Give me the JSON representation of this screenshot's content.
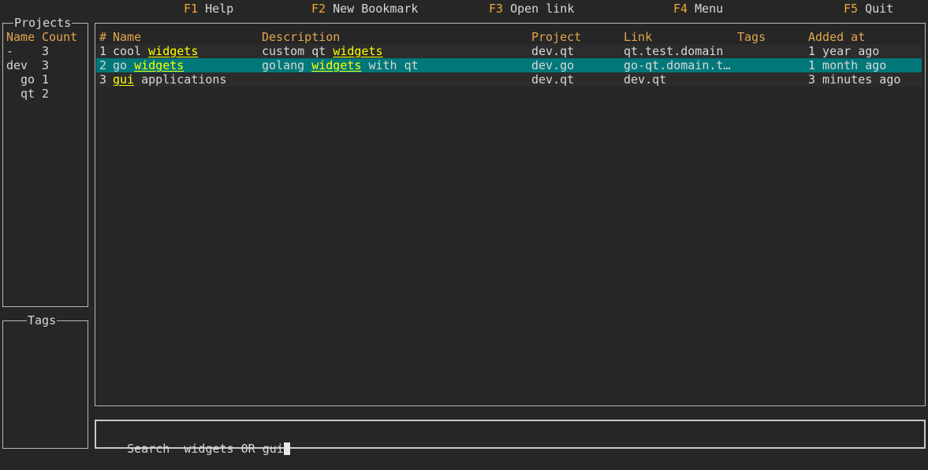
{
  "function_keys": [
    {
      "key": "F1",
      "label": "Help"
    },
    {
      "key": "F2",
      "label": "New Bookmark"
    },
    {
      "key": "F3",
      "label": "Open link"
    },
    {
      "key": "F4",
      "label": "Menu"
    },
    {
      "key": "F5",
      "label": "Quit"
    }
  ],
  "projects_panel": {
    "title": "Projects",
    "headers": {
      "name": "Name",
      "count": "Count"
    },
    "rows": [
      {
        "name": "-",
        "count": "3"
      },
      {
        "name": "dev",
        "count": "3"
      },
      {
        "name": "go",
        "count": "1"
      },
      {
        "name": "qt",
        "count": "2"
      }
    ]
  },
  "tags_panel": {
    "title": "Tags"
  },
  "bookmarks": {
    "headers": {
      "id": "#",
      "name": "Name",
      "description": "Description",
      "project": "Project",
      "link": "Link",
      "tags": "Tags",
      "added": "Added at"
    },
    "selected_index": 1,
    "highlight_color": "#ffff00",
    "selected_color": "#00787a",
    "header_color": "#e3a64f",
    "rows": [
      {
        "id": "1",
        "name": [
          {
            "t": "cool ",
            "hl": false
          },
          {
            "t": "widgets",
            "hl": true
          }
        ],
        "description": [
          {
            "t": "custom qt ",
            "hl": false
          },
          {
            "t": "widgets",
            "hl": true
          }
        ],
        "project": "dev.qt",
        "link": "qt.test.domain",
        "tags": "",
        "added": "1 year ago"
      },
      {
        "id": "2",
        "name": [
          {
            "t": "go ",
            "hl": false
          },
          {
            "t": "widgets",
            "hl": true
          }
        ],
        "description": [
          {
            "t": "golang ",
            "hl": false
          },
          {
            "t": "widgets",
            "hl": true
          },
          {
            "t": " with qt",
            "hl": false
          }
        ],
        "project": "dev.go",
        "link": "go-qt.domain.t…",
        "tags": "",
        "added": "1 month ago"
      },
      {
        "id": "3",
        "name": [
          {
            "t": "gui",
            "hl": true
          },
          {
            "t": " applications",
            "hl": false
          }
        ],
        "description": [],
        "project": "dev.qt",
        "link": "dev.qt",
        "tags": "",
        "added": "3 minutes ago"
      }
    ]
  },
  "search": {
    "label": "Search",
    "value": "widgets OR gui"
  }
}
